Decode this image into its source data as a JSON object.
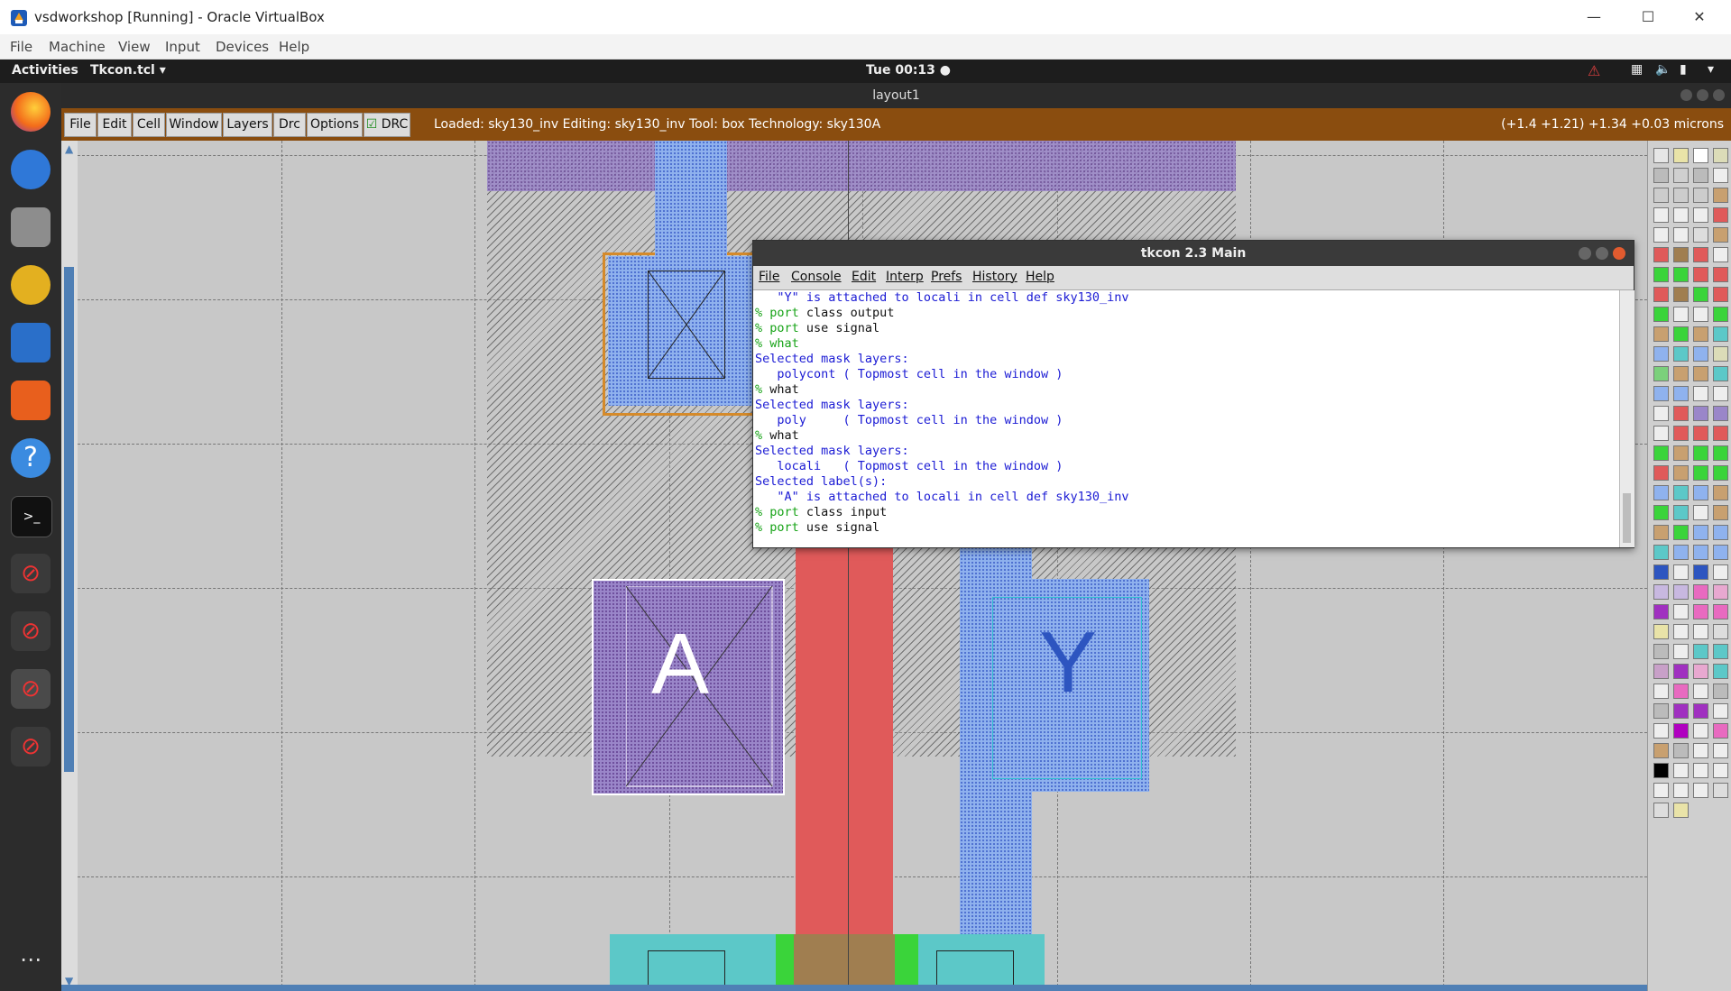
{
  "host_window": {
    "title": "vsdworkshop  [Running] - Oracle VirtualBox",
    "menu": [
      "File",
      "Machine",
      "View",
      "Input",
      "Devices",
      "Help"
    ]
  },
  "gnome": {
    "activities": "Activities",
    "app_name": "Tkcon.tcl ▾",
    "clock": "Tue 00:13 ●"
  },
  "magic": {
    "window_title": "layout1",
    "menu": [
      "File",
      "Edit",
      "Cell",
      "Window",
      "Layers",
      "Drc",
      "Options"
    ],
    "drc_label": "DRC",
    "status": "Loaded: sky130_inv Editing: sky130_inv Tool: box  Technology: sky130A",
    "coords": "(+1.4 +1.21) +1.34 +0.03 microns",
    "labels": {
      "a": "A",
      "y": "Y"
    }
  },
  "tkcon": {
    "title": "tkcon 2.3 Main",
    "menu": [
      "File",
      "Console",
      "Edit",
      "Interp",
      "Prefs",
      "History",
      "Help"
    ],
    "lines": [
      {
        "prompt": "",
        "cmd": "",
        "out": "   \"Y\" is attached to locali in cell def sky130_inv"
      },
      {
        "prompt": "% ",
        "cmd": "port",
        "out": " class output"
      },
      {
        "prompt": "% ",
        "cmd": "port",
        "out": " use signal"
      },
      {
        "prompt": "% ",
        "cmd": "what",
        "out": ""
      },
      {
        "prompt": "",
        "cmd": "",
        "out": "Selected mask layers:"
      },
      {
        "prompt": "",
        "cmd": "",
        "out": "   polycont ( Topmost cell in the window )"
      },
      {
        "prompt": "% ",
        "cmd": "",
        "out": "what"
      },
      {
        "prompt": "",
        "cmd": "",
        "out": "Selected mask layers:"
      },
      {
        "prompt": "",
        "cmd": "",
        "out": "   poly     ( Topmost cell in the window )"
      },
      {
        "prompt": "% ",
        "cmd": "",
        "out": "what"
      },
      {
        "prompt": "",
        "cmd": "",
        "out": "Selected mask layers:"
      },
      {
        "prompt": "",
        "cmd": "",
        "out": "   locali   ( Topmost cell in the window )"
      },
      {
        "prompt": "",
        "cmd": "",
        "out": "Selected label(s):"
      },
      {
        "prompt": "",
        "cmd": "",
        "out": "   \"A\" is attached to locali in cell def sky130_inv"
      },
      {
        "prompt": "% ",
        "cmd": "port",
        "out": " class input"
      },
      {
        "prompt": "% ",
        "cmd": "port",
        "out": " use signal"
      }
    ]
  },
  "colors": {
    "magic_menu_bar": "#8a4d0f",
    "poly_red": "#e05a5a",
    "locali_blue": "#8fb2ee",
    "diff_green": "#3ad43a"
  }
}
